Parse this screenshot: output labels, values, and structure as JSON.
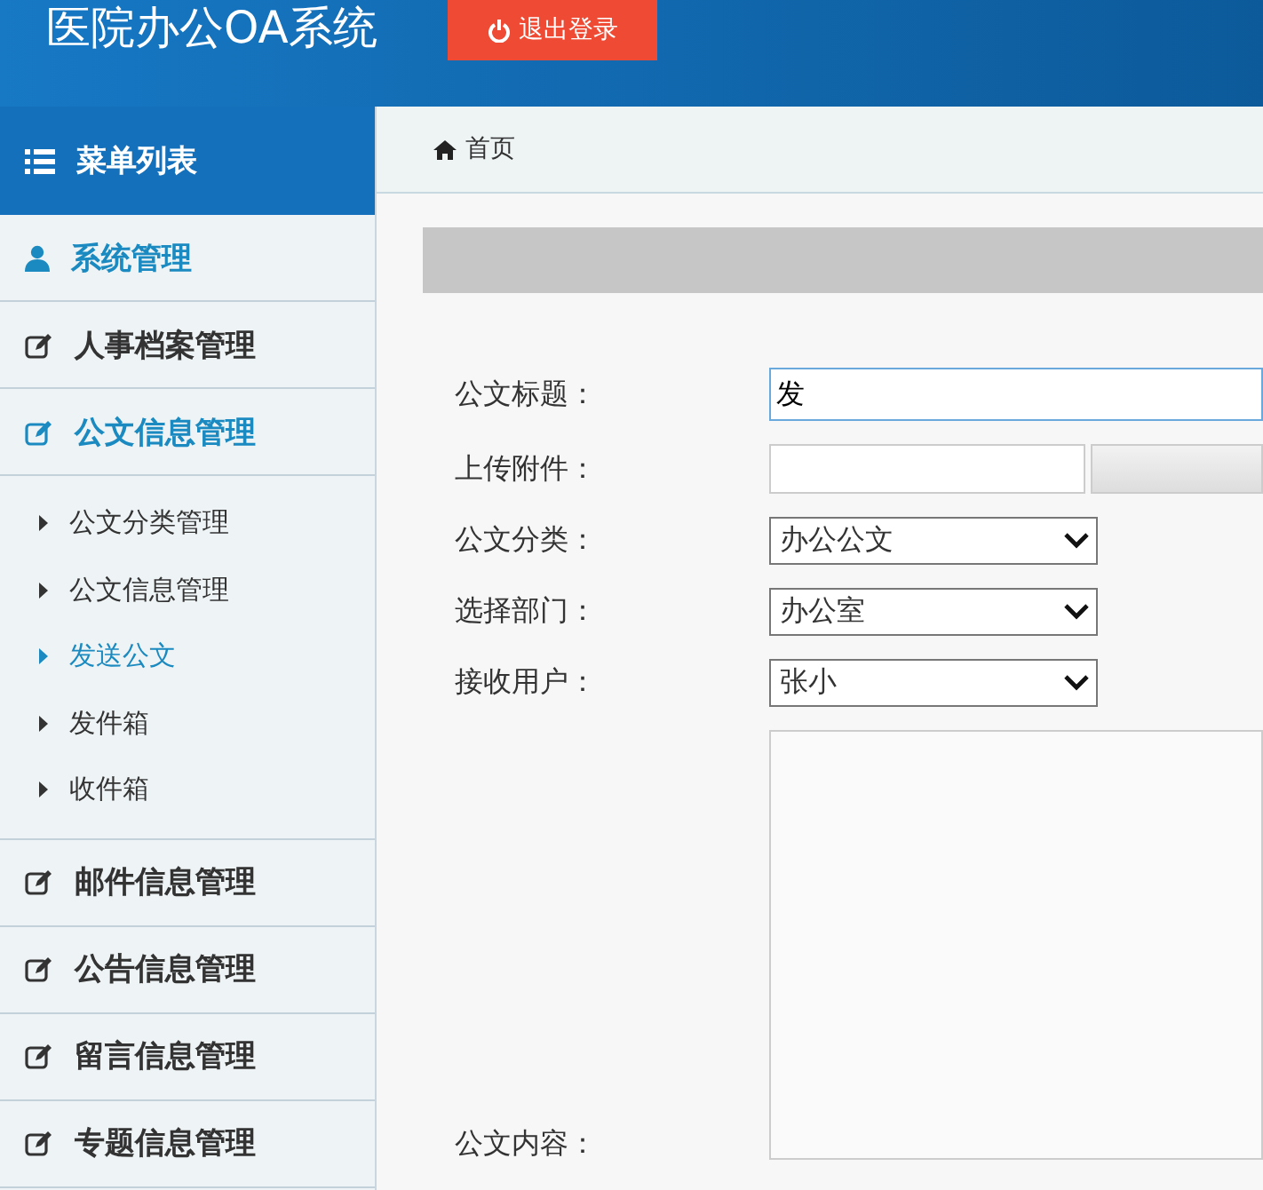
{
  "header": {
    "title": "医院办公OA系统",
    "logout": "退出登录"
  },
  "sidebar": {
    "heading": "菜单列表",
    "groups": [
      {
        "label": "系统管理",
        "kind": "user",
        "selected": true
      },
      {
        "label": "人事档案管理",
        "kind": "edit",
        "selected": false
      },
      {
        "label": "公文信息管理",
        "kind": "edit",
        "selected": true,
        "children": [
          {
            "label": "公文分类管理",
            "selected": false
          },
          {
            "label": "公文信息管理",
            "selected": false
          },
          {
            "label": "发送公文",
            "selected": true
          },
          {
            "label": "发件箱",
            "selected": false
          },
          {
            "label": "收件箱",
            "selected": false
          }
        ]
      },
      {
        "label": "邮件信息管理",
        "kind": "edit",
        "selected": false
      },
      {
        "label": "公告信息管理",
        "kind": "edit",
        "selected": false
      },
      {
        "label": "留言信息管理",
        "kind": "edit",
        "selected": false
      },
      {
        "label": "专题信息管理",
        "kind": "edit",
        "selected": false
      }
    ]
  },
  "breadcrumb": "首页",
  "form": [
    {
      "kind": "text",
      "label": "公文标题：",
      "value": "发"
    },
    {
      "kind": "file",
      "label": "上传附件："
    },
    {
      "kind": "select",
      "label": "公文分类：",
      "value": "办公公文"
    },
    {
      "kind": "select",
      "label": "选择部门：",
      "value": "办公室"
    },
    {
      "kind": "select",
      "label": "接收用户：",
      "value": "张小"
    },
    {
      "kind": "textarea",
      "label": "公文内容："
    }
  ]
}
